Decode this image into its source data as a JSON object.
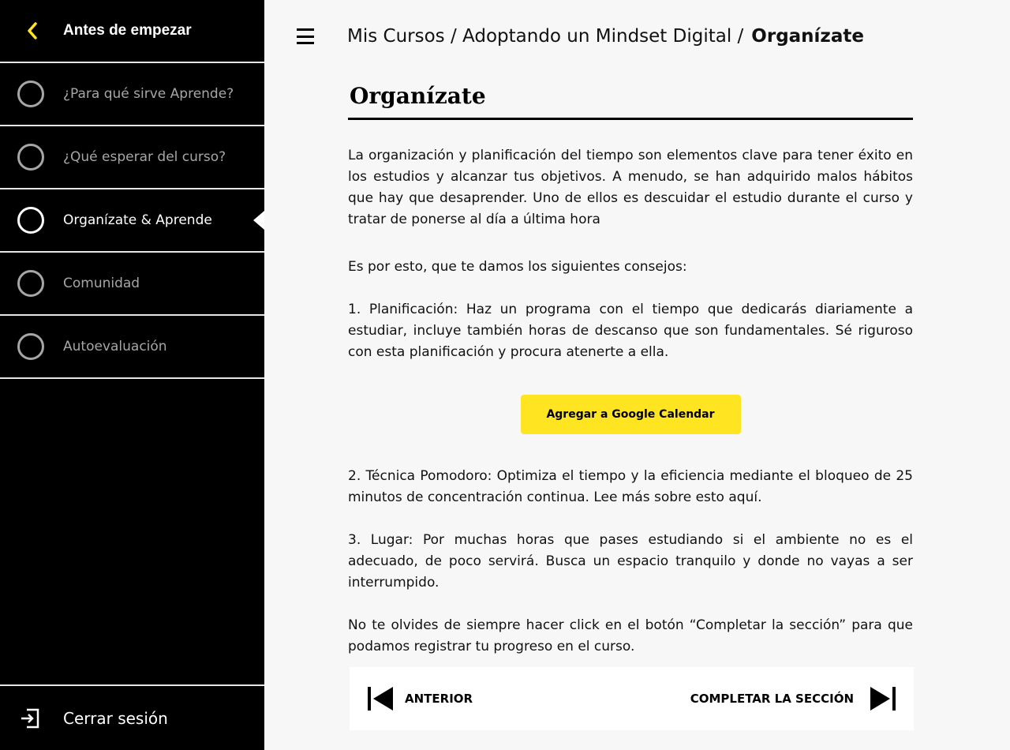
{
  "sidebar": {
    "title": "Antes de empezar",
    "items": [
      {
        "label": "¿Para qué sirve Aprende?",
        "active": false
      },
      {
        "label": "¿Qué esperar del curso?",
        "active": false
      },
      {
        "label": "Organízate & Aprende",
        "active": true
      },
      {
        "label": "Comunidad",
        "active": false
      },
      {
        "label": "Autoevaluación",
        "active": false
      }
    ],
    "logout_label": "Cerrar sesión"
  },
  "breadcrumb": {
    "path": "Mis Cursos / Adoptando un Mindset Digital /",
    "current": "Organízate"
  },
  "content": {
    "title": "Organízate",
    "paragraphs": [
      "La organización y planificación del tiempo son elementos clave para tener éxito en los estudios y alcanzar tus objetivos.  A menudo, se han adquirido malos hábitos que hay que desaprender. Uno de ellos es descuidar el estudio durante el curso y tratar de ponerse al día a última hora",
      "Es por esto, que te damos los siguientes consejos:",
      "1. Planificación: Haz un programa con el tiempo que dedicarás diariamente a estudiar, incluye también horas de descanso que son fundamentales. Sé riguroso con esta planificación y procura atenerte a ella.",
      "2. Técnica Pomodoro: Optimiza el tiempo y la eficiencia mediante el bloqueo de 25 minutos de concentración continua. Lee más sobre esto aquí.",
      "3. Lugar: Por muchas horas que pases estudiando si el ambiente no es el adecuado, de poco servirá. Busca un espacio tranquilo y donde no vayas a ser interrumpido.",
      "No te olvides de siempre hacer click en el botón “Completar la sección” para que podamos registrar tu progreso en el curso."
    ],
    "calendar_button": "Agregar a Google Calendar"
  },
  "nav": {
    "prev_label": "ANTERIOR",
    "next_label": "COMPLETAR LA SECCIÓN"
  },
  "colors": {
    "sidebar_bg": "#000000",
    "accent_yellow": "#ffe422",
    "page_bg": "#f7f7f7",
    "inactive_text": "#a6a6a6"
  },
  "icons": {
    "back": "chevron-left-icon",
    "menu": "hamburger-menu-icon",
    "logout": "logout-icon",
    "prev": "skip-previous-icon",
    "next": "skip-next-icon"
  }
}
